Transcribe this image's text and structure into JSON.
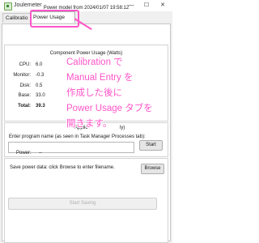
{
  "window": {
    "title": "Joulemeter",
    "icon": "joulemeter-app-icon",
    "controls": {
      "minimize": "—",
      "maximize": "☐",
      "close": "✕"
    }
  },
  "tabs": [
    {
      "label": "Calibratio",
      "active": false
    },
    {
      "label": "Power Usage",
      "active": true
    }
  ],
  "power_model": {
    "text": "Power model from 2024/01/07 19:58:12"
  },
  "component_usage": {
    "title": "Component Power Usage (Watts)",
    "rows": [
      {
        "label": "CPU:",
        "value": "6.0"
      },
      {
        "label": "Monitor:",
        "value": "-0.3"
      },
      {
        "label": "Disk:",
        "value": "0.5"
      },
      {
        "label": "Base:",
        "value": "33.0"
      },
      {
        "label": "Total:",
        "value": "39.3"
      }
    ]
  },
  "application_usage": {
    "title": "Application Power (Watts, approx only)",
    "title_visible": "Applic",
    "title_tail": "ly)",
    "prompt": "Enter program name (as seen in Task Manager Processes tab):",
    "program_value": "",
    "start_label": "Start",
    "power_label": "Power:",
    "power_value": "--"
  },
  "save": {
    "prompt": "Save power data: click Browse to enter filename.",
    "browse_label": "Browse",
    "start_saving_label": "Start Saving"
  },
  "overlay_note": {
    "lines": [
      "Calibration で",
      "Manual Entry を",
      "作成した後に",
      "Power Usage タブを",
      "開きます。"
    ],
    "color": "#ff55c8"
  }
}
